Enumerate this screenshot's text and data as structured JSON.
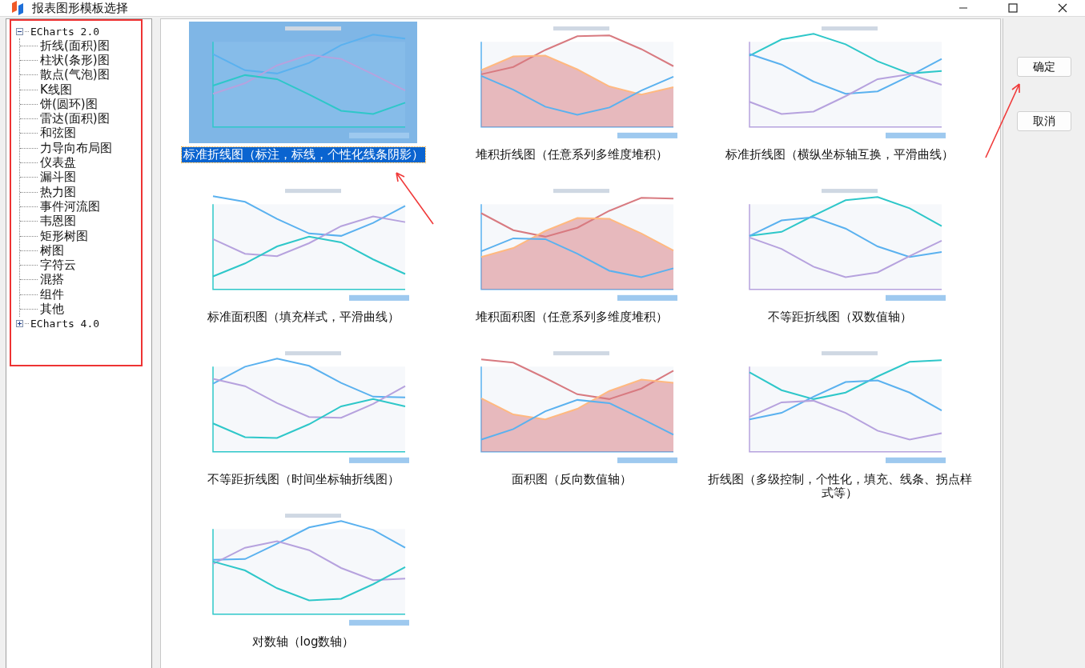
{
  "window": {
    "title": "报表图形模板选择"
  },
  "tree": [
    {
      "label": "ECharts 2.0",
      "expanded": true,
      "children": [
        {
          "label": "折线(面积)图"
        },
        {
          "label": "柱状(条形)图"
        },
        {
          "label": "散点(气泡)图"
        },
        {
          "label": "K线图"
        },
        {
          "label": "饼(圆环)图"
        },
        {
          "label": "雷达(面积)图"
        },
        {
          "label": "和弦图"
        },
        {
          "label": "力导向布局图"
        },
        {
          "label": "仪表盘"
        },
        {
          "label": "漏斗图"
        },
        {
          "label": "热力图"
        },
        {
          "label": "事件河流图"
        },
        {
          "label": "韦恩图"
        },
        {
          "label": "矩形树图"
        },
        {
          "label": "树图"
        },
        {
          "label": "字符云"
        },
        {
          "label": "混搭"
        },
        {
          "label": "组件"
        },
        {
          "label": "其他"
        }
      ]
    },
    {
      "label": "ECharts 4.0",
      "expanded": false
    }
  ],
  "templates": [
    {
      "caption": "标准折线图（标注，标线，个性化线条阴影）",
      "selected": true
    },
    {
      "caption": "堆积折线图（任意系列多维度堆积）",
      "selected": false
    },
    {
      "caption": "标准折线图（横纵坐标轴互换，平滑曲线）",
      "selected": false
    },
    {
      "caption": "标准面积图（填充样式，平滑曲线）",
      "selected": false
    },
    {
      "caption": "堆积面积图（任意系列多维度堆积）",
      "selected": false
    },
    {
      "caption": "不等距折线图（双数值轴）",
      "selected": false
    },
    {
      "caption": "不等距折线图（时间坐标轴折线图）",
      "selected": false
    },
    {
      "caption": "面积图（反向数值轴）",
      "selected": false
    },
    {
      "caption": "折线图（多级控制，个性化，填充、线条、拐点样式等）",
      "selected": false
    },
    {
      "caption": "对数轴（log数轴）",
      "selected": false
    }
  ],
  "buttons": [
    {
      "label": "确定"
    },
    {
      "label": "取消"
    }
  ]
}
